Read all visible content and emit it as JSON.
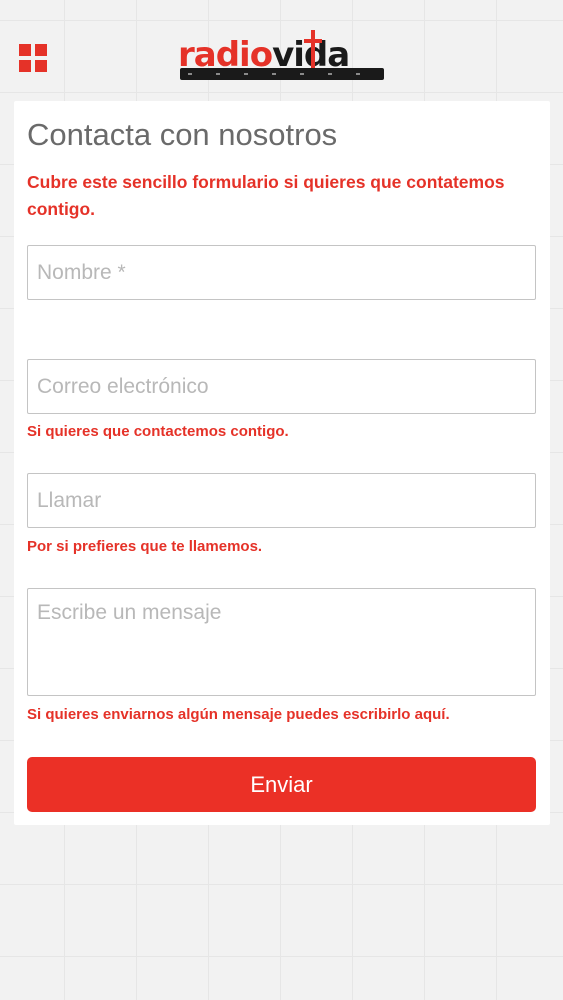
{
  "colors": {
    "accent": "#e53228",
    "button": "#eb3026",
    "title": "#6a6a6a",
    "background": "#f2f2f2"
  },
  "header": {
    "menu_icon": "grid-menu-icon",
    "logo": {
      "text_radio": "radio",
      "text_vida": "vida"
    }
  },
  "form": {
    "title": "Contacta con nosotros",
    "intro": "Cubre este sencillo formulario si quieres que contatemos contigo.",
    "name": {
      "placeholder": "Nombre *",
      "value": ""
    },
    "email": {
      "placeholder": "Correo electrónico",
      "value": "",
      "hint": "Si quieres que contactemos contigo."
    },
    "phone": {
      "placeholder": "Llamar",
      "value": "",
      "hint": "Por si prefieres que te llamemos."
    },
    "message": {
      "placeholder": "Escribe un mensaje",
      "value": "",
      "hint": "Si quieres enviarnos algún mensaje puedes escribirlo aquí."
    },
    "submit_label": "Enviar"
  }
}
